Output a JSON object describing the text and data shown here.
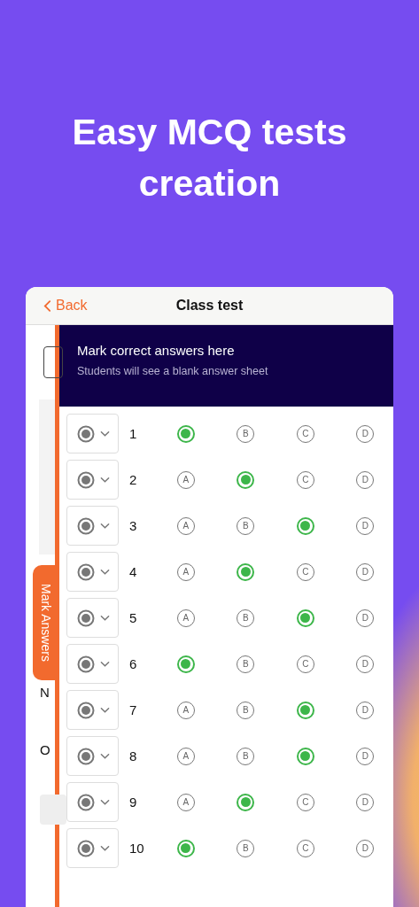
{
  "headline": "Easy MCQ tests creation",
  "nav": {
    "back": "Back",
    "title": "Class test"
  },
  "behind": {
    "labels": [
      "N",
      "O"
    ]
  },
  "tab": {
    "label": "Mark Answers"
  },
  "banner": {
    "heading": "Mark correct answers here",
    "subtext": "Students will see a blank answer sheet"
  },
  "rows": [
    {
      "number": "1",
      "options": [
        {
          "selected": true
        },
        {
          "label": "B",
          "selected": false
        },
        {
          "label": "C",
          "selected": false
        },
        {
          "label": "D",
          "selected": false
        }
      ]
    },
    {
      "number": "2",
      "options": [
        {
          "label": "A",
          "selected": false
        },
        {
          "selected": true
        },
        {
          "label": "C",
          "selected": false
        },
        {
          "label": "D",
          "selected": false
        }
      ]
    },
    {
      "number": "3",
      "options": [
        {
          "label": "A",
          "selected": false
        },
        {
          "label": "B",
          "selected": false
        },
        {
          "selected": true
        },
        {
          "label": "D",
          "selected": false
        }
      ]
    },
    {
      "number": "4",
      "options": [
        {
          "label": "A",
          "selected": false
        },
        {
          "selected": true
        },
        {
          "label": "C",
          "selected": false
        },
        {
          "label": "D",
          "selected": false
        }
      ]
    },
    {
      "number": "5",
      "options": [
        {
          "label": "A",
          "selected": false
        },
        {
          "label": "B",
          "selected": false
        },
        {
          "selected": true
        },
        {
          "label": "D",
          "selected": false
        }
      ]
    },
    {
      "number": "6",
      "options": [
        {
          "selected": true
        },
        {
          "label": "B",
          "selected": false
        },
        {
          "label": "C",
          "selected": false
        },
        {
          "label": "D",
          "selected": false
        }
      ]
    },
    {
      "number": "7",
      "options": [
        {
          "label": "A",
          "selected": false
        },
        {
          "label": "B",
          "selected": false
        },
        {
          "selected": true
        },
        {
          "label": "D",
          "selected": false
        }
      ]
    },
    {
      "number": "8",
      "options": [
        {
          "label": "A",
          "selected": false
        },
        {
          "label": "B",
          "selected": false
        },
        {
          "selected": true
        },
        {
          "label": "D",
          "selected": false
        }
      ]
    },
    {
      "number": "9",
      "options": [
        {
          "label": "A",
          "selected": false
        },
        {
          "selected": true
        },
        {
          "label": "C",
          "selected": false
        },
        {
          "label": "D",
          "selected": false
        }
      ]
    },
    {
      "number": "10",
      "options": [
        {
          "selected": true
        },
        {
          "label": "B",
          "selected": false
        },
        {
          "label": "C",
          "selected": false
        },
        {
          "label": "D",
          "selected": false
        }
      ]
    }
  ]
}
